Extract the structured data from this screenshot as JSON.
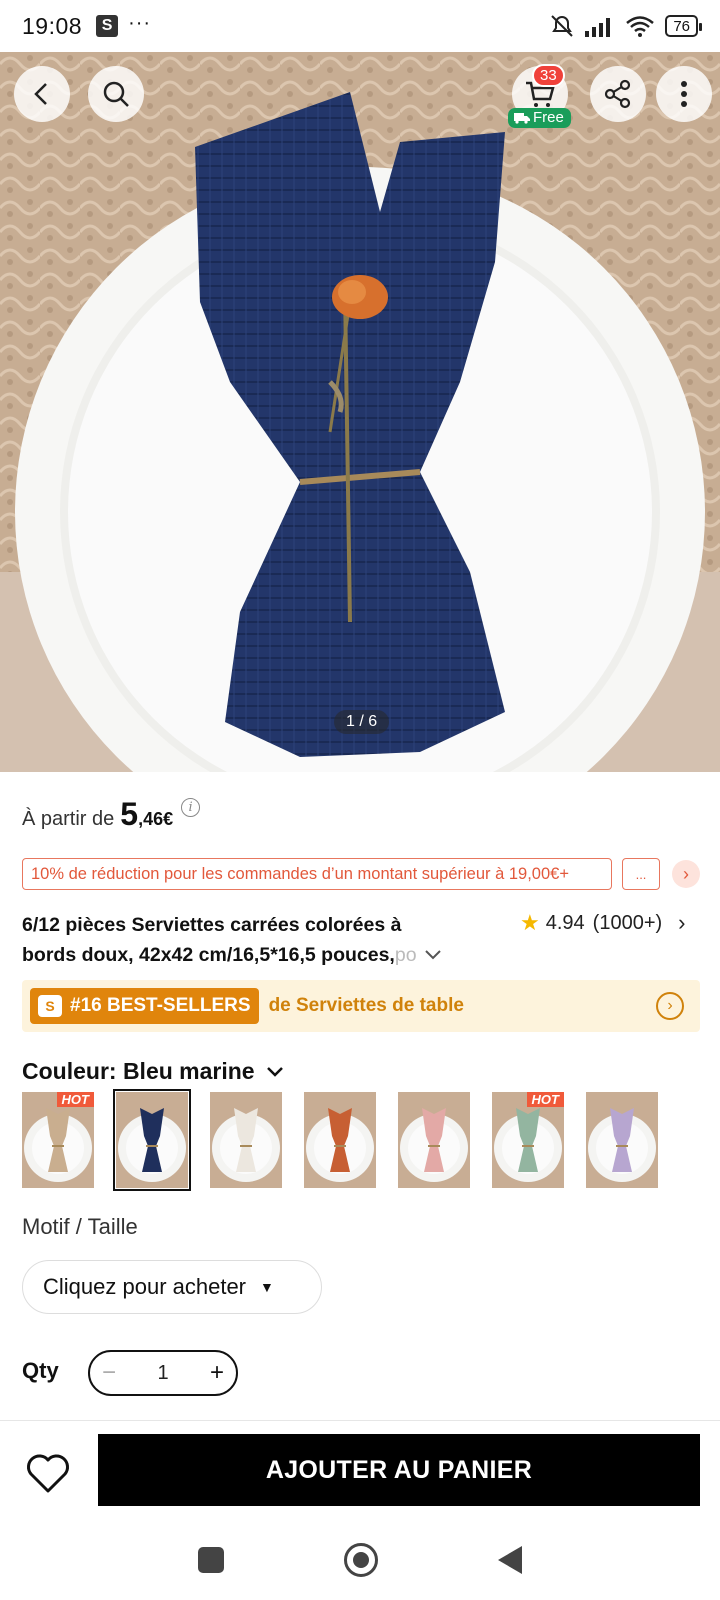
{
  "status_bar": {
    "time": "19:08",
    "app_icon": "S",
    "dots": "···",
    "battery": "76"
  },
  "hero": {
    "image_counter": "1 / 6",
    "cart_count": "33",
    "free_label": "Free"
  },
  "price": {
    "prefix": "À partir de",
    "main": "5",
    "decimal": ",46€"
  },
  "promo": {
    "text": "10% de réduction pour les commandes d’un montant supérieur à 19,00€+",
    "more": "..."
  },
  "product": {
    "title_line1": "6/12 pièces Serviettes carrées colorées à",
    "title_line2": "bords doux, 42x42 cm/16,5*16,5 pouces,",
    "title_fade": "po",
    "rating": "4.94",
    "reviews": "(1000+)"
  },
  "bestseller": {
    "badge": "#16 BEST-SELLERS",
    "category": "de Serviettes de table"
  },
  "color": {
    "label": "Couleur: Bleu marine",
    "hot_tag": "HOT",
    "swatches": [
      {
        "name": "beige",
        "color": "#c9ae8f",
        "hot": true
      },
      {
        "name": "navy",
        "color": "#1f2f5c",
        "hot": false
      },
      {
        "name": "white",
        "color": "#ece7df",
        "hot": false
      },
      {
        "name": "rust",
        "color": "#c75f33",
        "hot": false
      },
      {
        "name": "pink",
        "color": "#e3a9a6",
        "hot": false
      },
      {
        "name": "sage",
        "color": "#93b5a0",
        "hot": true
      },
      {
        "name": "lavender",
        "color": "#b7a6d0",
        "hot": false
      }
    ]
  },
  "motif": {
    "label": "Motif / Taille",
    "select": "Cliquez pour acheter"
  },
  "qty": {
    "label": "Qty",
    "value": "1",
    "minus": "−",
    "plus": "+"
  },
  "cta": {
    "add_to_cart": "AJOUTER AU PANIER"
  },
  "colors": {
    "accent_orange": "#e2583b",
    "bestseller_bg": "#fdf3dc",
    "bestseller_badge": "#e0850c",
    "free_green": "#1a9d5a",
    "star": "#f5b800"
  }
}
